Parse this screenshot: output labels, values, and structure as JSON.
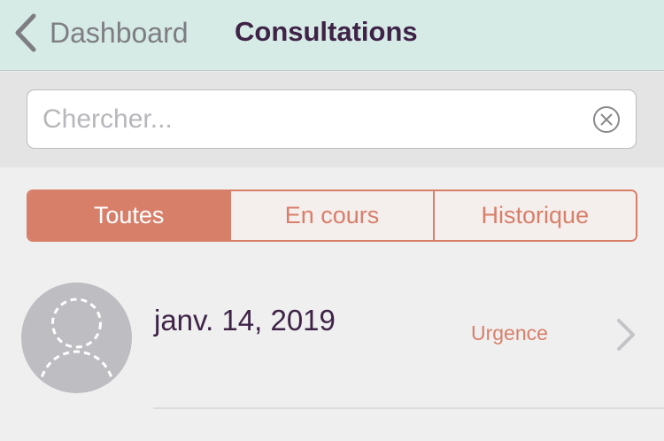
{
  "navbar": {
    "back_label": "Dashboard",
    "title": "Consultations"
  },
  "search": {
    "placeholder": "Chercher...",
    "value": ""
  },
  "tabs": [
    {
      "label": "Toutes",
      "active": true
    },
    {
      "label": "En cours",
      "active": false
    },
    {
      "label": "Historique",
      "active": false
    }
  ],
  "consultations": [
    {
      "date": "janv. 14, 2019",
      "status": "Urgence"
    }
  ],
  "icons": {
    "back": "chevron-left-icon",
    "clear": "clear-circle-icon",
    "avatar": "user-placeholder-icon",
    "disclosure": "chevron-right-icon"
  },
  "colors": {
    "navbar_bg": "#d6eae6",
    "accent": "#d87f6a",
    "title": "#3e2347",
    "avatar_bg": "#bdbdc2"
  }
}
